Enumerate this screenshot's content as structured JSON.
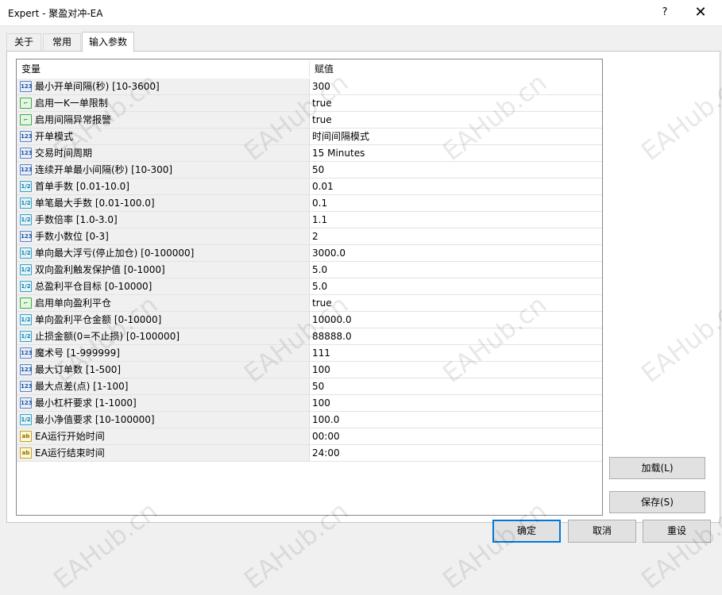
{
  "window": {
    "title": "Expert - 聚盈对冲-EA",
    "help_label": "?",
    "close_label": "✕"
  },
  "tabs": [
    {
      "label": "关于"
    },
    {
      "label": "常用"
    },
    {
      "label": "输入参数",
      "active": true
    }
  ],
  "grid": {
    "headers": {
      "variable": "变量",
      "value": "赋值"
    },
    "rows": [
      {
        "type": "int",
        "name": "最小开单间隔(秒) [10-3600]",
        "value": "300"
      },
      {
        "type": "bool",
        "name": "启用一K一单限制",
        "value": "true"
      },
      {
        "type": "bool",
        "name": "启用间隔异常报警",
        "value": "true"
      },
      {
        "type": "int",
        "name": "开单模式",
        "value": "时间间隔模式"
      },
      {
        "type": "int",
        "name": "交易时间周期",
        "value": "15 Minutes"
      },
      {
        "type": "int",
        "name": "连续开单最小间隔(秒) [10-300]",
        "value": "50"
      },
      {
        "type": "double",
        "name": "首单手数 [0.01-10.0]",
        "value": "0.01"
      },
      {
        "type": "double",
        "name": "单笔最大手数 [0.01-100.0]",
        "value": "0.1"
      },
      {
        "type": "double",
        "name": "手数倍率 [1.0-3.0]",
        "value": "1.1"
      },
      {
        "type": "int",
        "name": "手数小数位 [0-3]",
        "value": "2"
      },
      {
        "type": "double",
        "name": "单向最大浮亏(停止加仓) [0-100000]",
        "value": "3000.0"
      },
      {
        "type": "double",
        "name": "双向盈利触发保护值 [0-1000]",
        "value": "5.0"
      },
      {
        "type": "double",
        "name": "总盈利平仓目标 [0-10000]",
        "value": "5.0"
      },
      {
        "type": "bool",
        "name": "启用单向盈利平仓",
        "value": "true"
      },
      {
        "type": "double",
        "name": "单向盈利平仓金额 [0-10000]",
        "value": "10000.0"
      },
      {
        "type": "double",
        "name": "止损金额(0=不止损) [0-100000]",
        "value": "88888.0"
      },
      {
        "type": "int",
        "name": "魔术号 [1-999999]",
        "value": "111"
      },
      {
        "type": "int",
        "name": "最大订单数 [1-500]",
        "value": "100"
      },
      {
        "type": "int",
        "name": "最大点差(点) [1-100]",
        "value": "50"
      },
      {
        "type": "int",
        "name": "最小杠杆要求 [1-1000]",
        "value": "100"
      },
      {
        "type": "double",
        "name": "最小净值要求 [10-100000]",
        "value": "100.0"
      },
      {
        "type": "string",
        "name": "EA运行开始时间",
        "value": "00:00"
      },
      {
        "type": "string",
        "name": "EA运行结束时间",
        "value": "24:00"
      }
    ]
  },
  "icon_glyphs": {
    "int": "123",
    "double": "1/2",
    "bool": "⌐",
    "string": "ab"
  },
  "buttons": {
    "load": "加载(L)",
    "save": "保存(S)",
    "ok": "确定",
    "cancel": "取消",
    "reset": "重设"
  },
  "watermark": "EAHub.cn",
  "colors": {
    "default_button_border": "#0078d7",
    "grid_border": "#828790"
  }
}
